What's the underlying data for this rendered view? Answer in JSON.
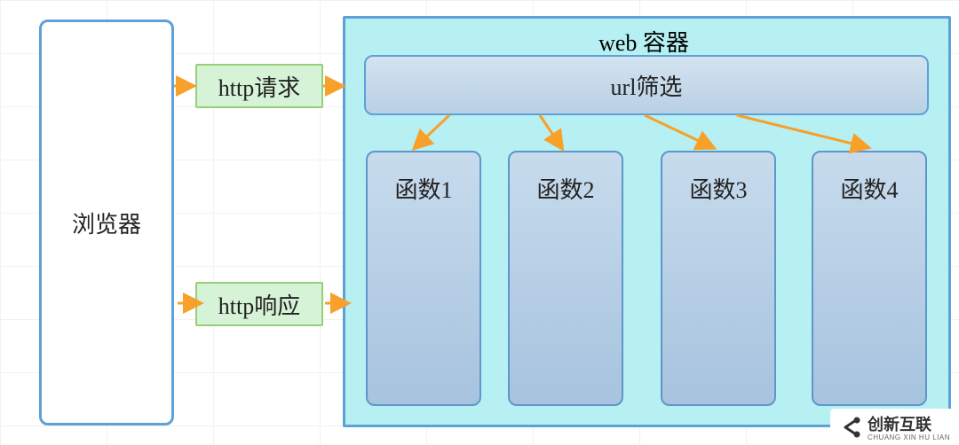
{
  "browser": {
    "label": "浏览器"
  },
  "http_request": {
    "label": "http请求"
  },
  "http_response": {
    "label": "http响应"
  },
  "container": {
    "title": "web 容器"
  },
  "url_filter": {
    "label": "url筛选"
  },
  "functions": {
    "fn1": "函数1",
    "fn2": "函数2",
    "fn3": "函数3",
    "fn4": "函数4"
  },
  "watermark": {
    "brand": "创新互联",
    "sub": "CHUANG XIN HU LIAN"
  },
  "arrow_color": "#f7a02a"
}
